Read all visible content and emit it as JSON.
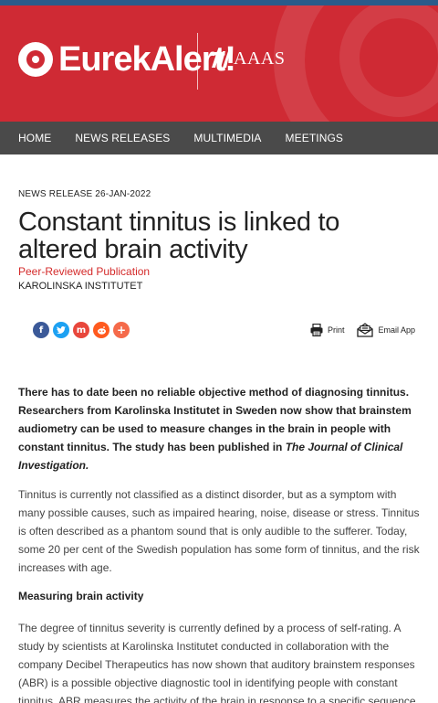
{
  "header": {
    "logo_text": "EurekAlert!",
    "partner_text": "AAAS"
  },
  "nav": {
    "items": [
      "HOME",
      "NEWS RELEASES",
      "MULTIMEDIA",
      "MEETINGS"
    ]
  },
  "article": {
    "release_line": "NEWS RELEASE 26-JAN-2022",
    "title": "Constant tinnitus is linked to altered brain activity",
    "publication_type": "Peer-Reviewed Publication",
    "institution": "KAROLINSKA INSTITUTET",
    "lead_part1": "There has to date been no reliable objective method of diagnosing tinnitus. Researchers from Karolinska Institutet in Sweden now show that brainstem audiometry can be used to measure changes in the brain in people with constant tinnitus. The study has been published in ",
    "lead_journal": "The Journal of Clinical Investigation.",
    "paragraph1": "Tinnitus is currently not classified as a distinct disorder, but as a symptom with many possible causes, such as impaired hearing, noise, disease or stress. Tinnitus is often described as a phantom sound that is only audible to the sufferer. Today, some 20 per cent of the Swedish population has some form of tinnitus, and the risk increases with age.",
    "subheading": "Measuring brain activity",
    "paragraph2": "The degree of tinnitus severity is currently defined by a process of self-rating. A study by scientists at Karolinska Institutet conducted in collaboration with the company Decibel Therapeutics has now shown that auditory brainstem responses (ABR) is a possible objective diagnostic tool in identifying people with constant tinnitus. ABR measures the activity of the brain in response to a specific sequence of sound stimuli."
  },
  "share": {
    "icons": [
      "facebook-icon",
      "twitter-icon",
      "mix-icon",
      "reddit-icon",
      "more-share-icon"
    ],
    "print_label": "Print",
    "email_label": "Email App"
  },
  "colors": {
    "banner_red": "#cf2a34",
    "nav_gray": "#4a4a4a",
    "peer_red": "#d42a2a"
  }
}
